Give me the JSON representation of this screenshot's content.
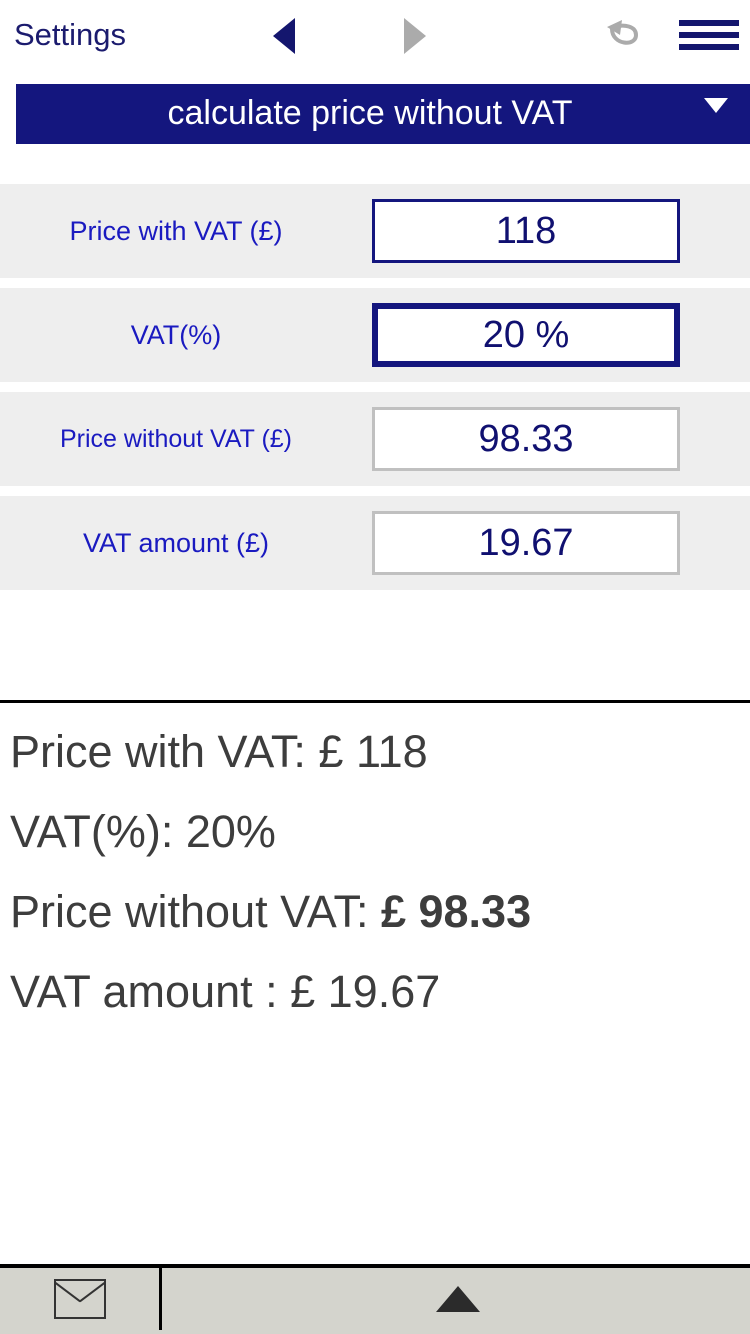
{
  "toolbar": {
    "title": "Settings",
    "prev_icon": "triangle-left-icon",
    "next_icon": "triangle-right-icon",
    "undo_icon": "undo-arrow-icon",
    "menu_icon": "hamburger-menu-icon",
    "accent_active": "#14166e",
    "accent_disabled": "#ababab"
  },
  "mode": {
    "selected": "calculate price without VAT",
    "caret_icon": "chevron-down-icon",
    "background": "#14167e",
    "text_color": "#ffffff"
  },
  "fields": [
    {
      "label": "Price with VAT (£)",
      "value": "118",
      "state": "editable",
      "name": "price-with-vat"
    },
    {
      "label": "VAT(%)",
      "value": "20 %",
      "state": "focused",
      "name": "vat-percent"
    },
    {
      "label": "Price without VAT (£)",
      "value": "98.33",
      "state": "readonly",
      "name": "price-without-vat"
    },
    {
      "label": "VAT amount (£)",
      "value": "19.67",
      "state": "readonly",
      "name": "vat-amount"
    }
  ],
  "results": {
    "line1_label": "Price with VAT: £ 118",
    "line2_label": "VAT(%): 20%",
    "line3_prefix": "Price without VAT: ",
    "line3_value": "£ 98.33",
    "line4_label": "VAT amount : £ 19.67"
  },
  "bottom_bar": {
    "mail_icon": "envelope-icon",
    "up_icon": "triangle-up-icon",
    "background": "#d4d4cd"
  }
}
